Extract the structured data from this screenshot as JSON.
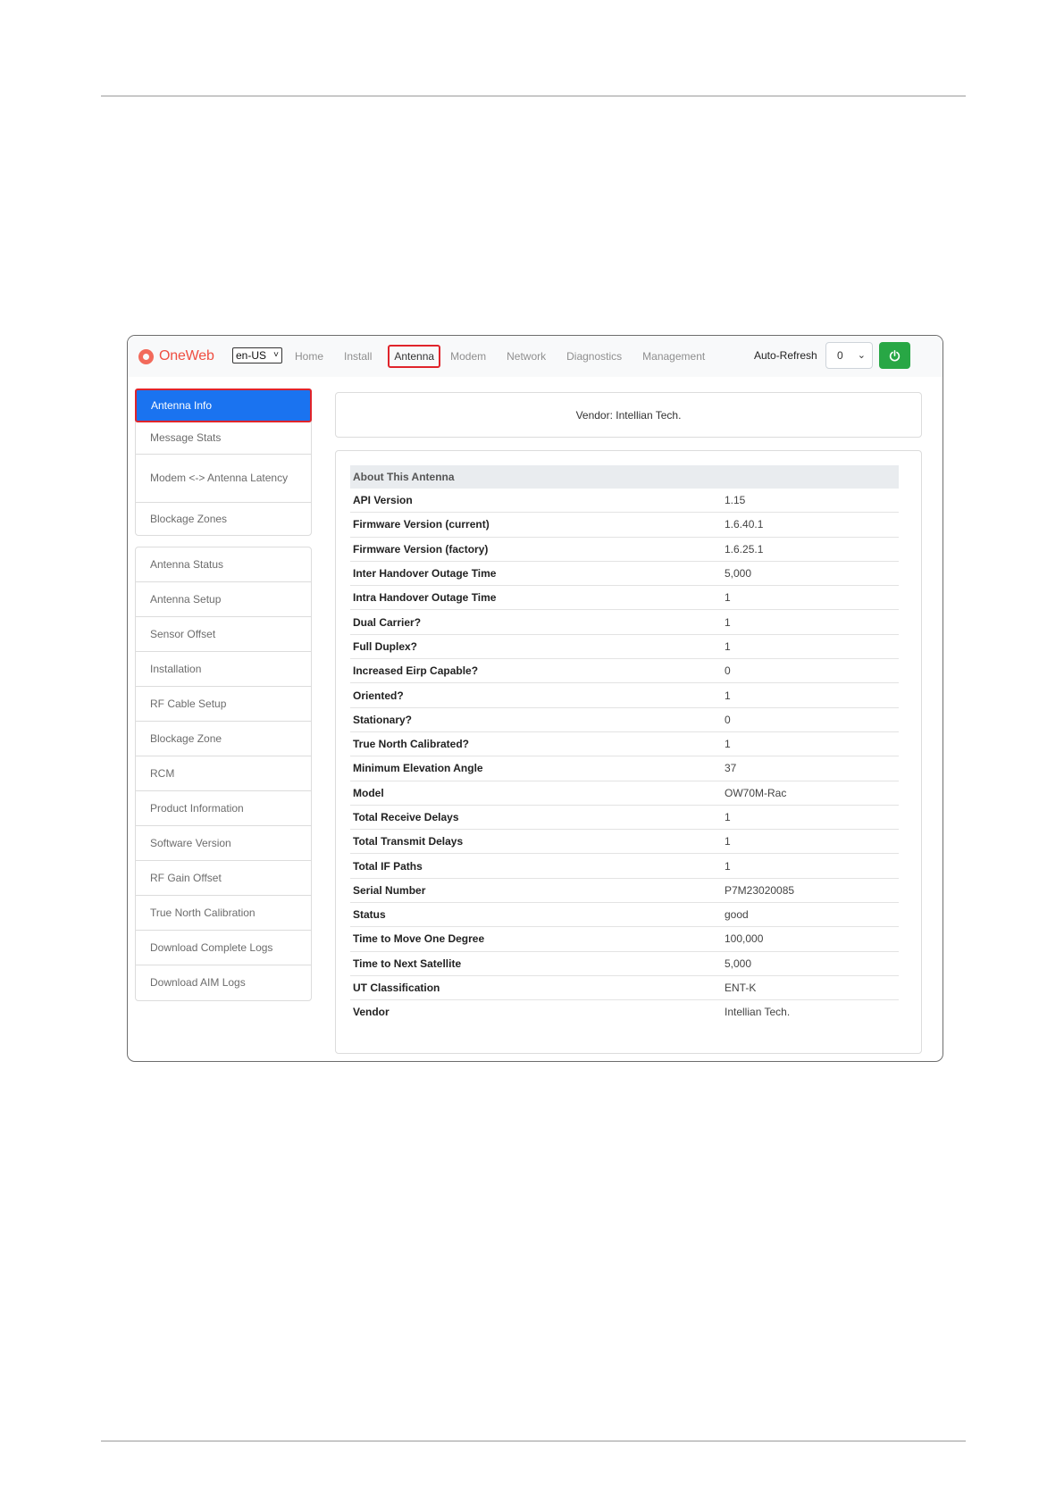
{
  "navbar": {
    "brand": "OneWeb",
    "language": "en-US",
    "links": [
      {
        "label": "Home",
        "active": false
      },
      {
        "label": "Install",
        "active": false
      },
      {
        "label": "Antenna",
        "active": true
      },
      {
        "label": "Modem",
        "active": false
      },
      {
        "label": "Network",
        "active": false
      },
      {
        "label": "Diagnostics",
        "active": false
      },
      {
        "label": "Management",
        "active": false
      }
    ],
    "auto_refresh_label": "Auto-Refresh",
    "auto_refresh_value": "0"
  },
  "sidebar": {
    "group1": [
      "Antenna Info",
      "Message Stats",
      "Modem <-> Antenna Latency",
      "Blockage Zones"
    ],
    "group2": [
      "Antenna Status",
      "Antenna Setup",
      "Sensor Offset",
      "Installation",
      "RF Cable Setup",
      "Blockage Zone",
      "RCM",
      "Product Information",
      "Software Version",
      "RF Gain Offset",
      "True North Calibration",
      "Download Complete Logs",
      "Download AIM Logs"
    ]
  },
  "vendor_banner": "Vendor: Intellian Tech.",
  "about": {
    "header": "About This Antenna",
    "rows": [
      [
        "API Version",
        "1.15"
      ],
      [
        "Firmware Version (current)",
        "1.6.40.1"
      ],
      [
        "Firmware Version (factory)",
        "1.6.25.1"
      ],
      [
        "Inter Handover Outage Time",
        "5,000"
      ],
      [
        "Intra Handover Outage Time",
        "1"
      ],
      [
        "Dual Carrier?",
        "1"
      ],
      [
        "Full Duplex?",
        "1"
      ],
      [
        "Increased Eirp Capable?",
        "0"
      ],
      [
        "Oriented?",
        "1"
      ],
      [
        "Stationary?",
        "0"
      ],
      [
        "True North Calibrated?",
        "1"
      ],
      [
        "Minimum Elevation Angle",
        "37"
      ],
      [
        "Model",
        "OW70M-Rac"
      ],
      [
        "Total Receive Delays",
        "1"
      ],
      [
        "Total Transmit Delays",
        "1"
      ],
      [
        "Total IF Paths",
        "1"
      ],
      [
        "Serial Number",
        "P7M23020085"
      ],
      [
        "Status",
        "good"
      ],
      [
        "Time to Move One Degree",
        "100,000"
      ],
      [
        "Time to Next Satellite",
        "5,000"
      ],
      [
        "UT Classification",
        "ENT-K"
      ],
      [
        "Vendor",
        "Intellian Tech."
      ]
    ]
  }
}
